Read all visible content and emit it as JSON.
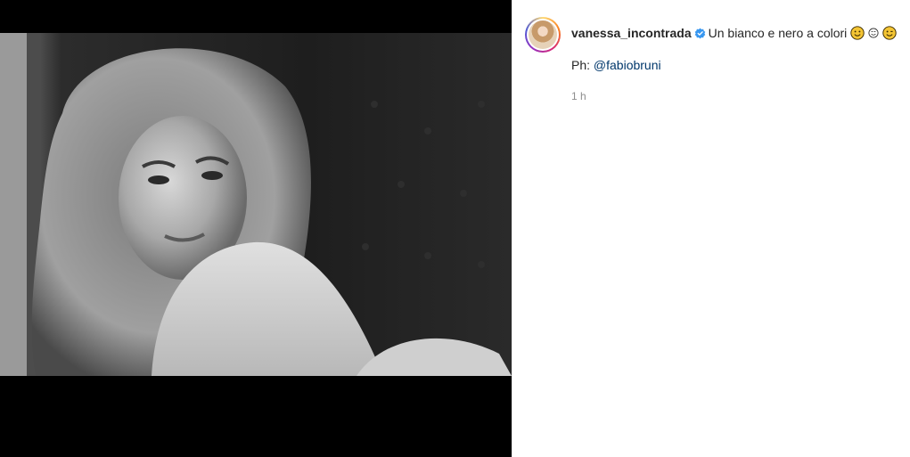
{
  "post": {
    "author": {
      "username": "vanessa_incontrada",
      "verified": true,
      "verified_color": "#3897f0",
      "avatar_icon": "profile-photo"
    },
    "caption": {
      "text": "Un bianco e nero a colori",
      "emojis": [
        "smiling-face-emoji",
        "relaxed-face-emoji",
        "winking-face-emoji"
      ],
      "credit_prefix": "Ph:",
      "credit_mention": "@fabiobruni"
    },
    "timestamp": "1 h",
    "media": {
      "type": "black-and-white photo",
      "background": "#000000"
    },
    "colors": {
      "mention": "#00376b",
      "timestamp": "#8e8e8e",
      "text": "#262626"
    }
  }
}
